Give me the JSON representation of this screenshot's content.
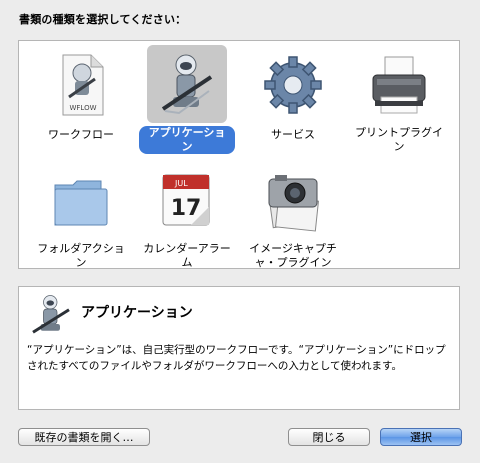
{
  "dialog": {
    "prompt": "書類の種類を選択してください："
  },
  "templates": [
    {
      "label": "ワークフロー",
      "icon": "workflow-document-icon",
      "badge": "WFLOW",
      "selected": false
    },
    {
      "label": "アプリケーション",
      "icon": "automator-robot-icon",
      "selected": true
    },
    {
      "label": "サービス",
      "icon": "gear-icon",
      "selected": false
    },
    {
      "label": "プリントプラグイン",
      "icon": "printer-icon",
      "selected": false
    },
    {
      "label": "フォルダアクション",
      "icon": "folder-icon",
      "selected": false
    },
    {
      "label": "カレンダーアラーム",
      "icon": "calendar-icon",
      "month": "JUL",
      "day": "17",
      "selected": false
    },
    {
      "label": "イメージキャプチャ・プラグイン",
      "icon": "camera-icon",
      "selected": false
    }
  ],
  "description": {
    "title": "アプリケーション",
    "text": "“アプリケーション”は、自己実行型のワークフローです。“アプリケーション”にドロップされたすべてのファイルやフォルダがワークフローへの入力として使われます。"
  },
  "buttons": {
    "open_existing": "既存の書類を開く…",
    "close": "閉じる",
    "choose": "選択"
  },
  "colors": {
    "selection": "#3d7ad8",
    "background": "#ececec"
  }
}
